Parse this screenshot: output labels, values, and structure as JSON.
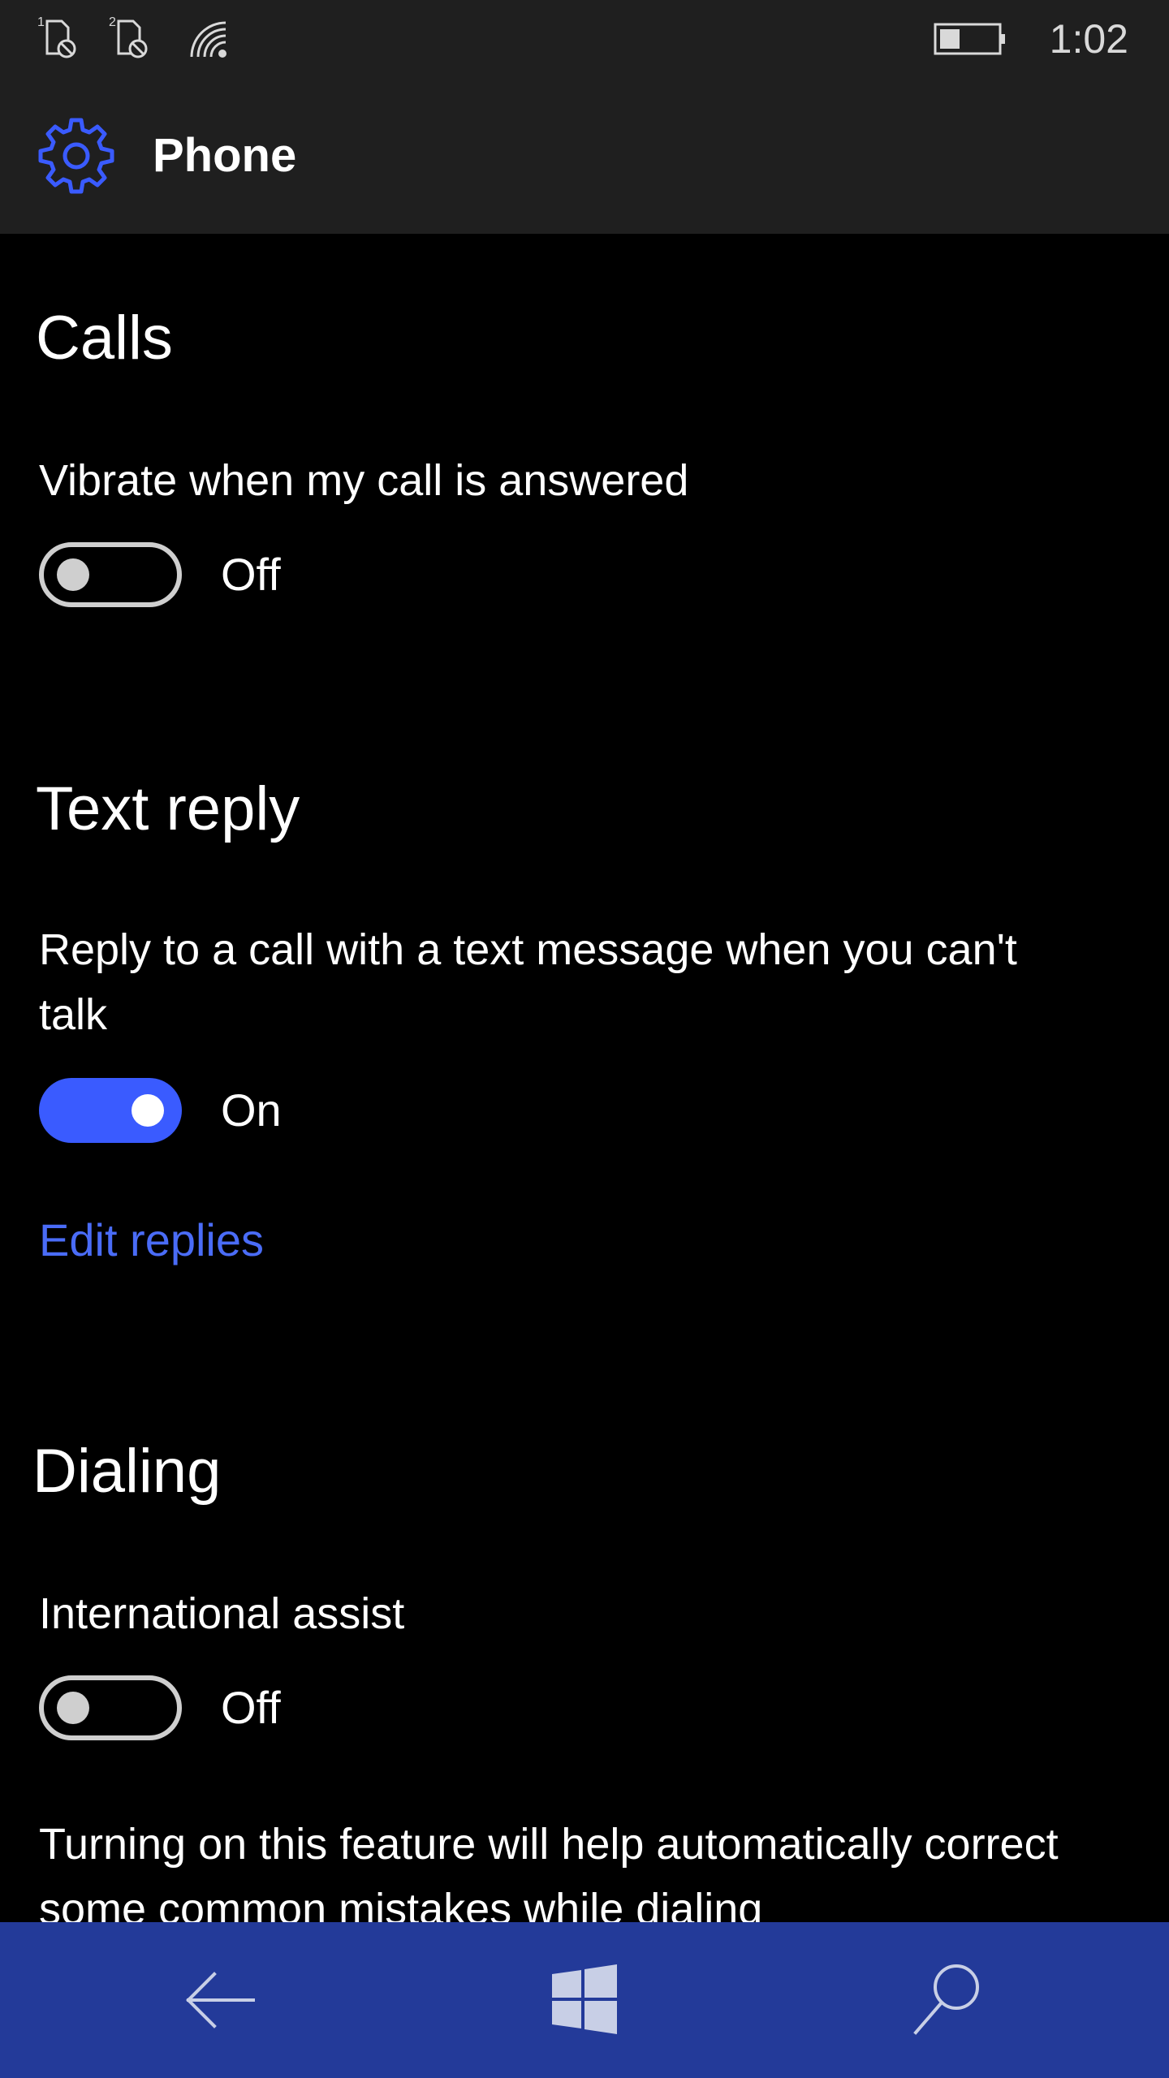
{
  "status_bar": {
    "sim1_label": "1",
    "sim2_label": "2",
    "time": "1:02",
    "battery_level": 0.35
  },
  "header": {
    "title": "Phone",
    "icon": "gear-icon",
    "accent_color": "#3a5bff"
  },
  "sections": {
    "calls": {
      "title": "Calls",
      "vibrate_label": "Vibrate when my call is answered",
      "vibrate_state": "Off",
      "vibrate_on": false
    },
    "text_reply": {
      "title": "Text reply",
      "reply_label": "Reply to a call with a text message when you can't talk",
      "reply_state": "On",
      "reply_on": true,
      "edit_link": "Edit replies"
    },
    "dialing": {
      "title": "Dialing",
      "intl_label": "International assist",
      "intl_state": "Off",
      "intl_on": false,
      "description": "Turning on this feature will help automatically correct some common mistakes while dialing"
    }
  },
  "nav_bar": {
    "back_icon": "back-arrow-icon",
    "start_icon": "windows-logo-icon",
    "search_icon": "search-icon",
    "color": "#233a99"
  }
}
